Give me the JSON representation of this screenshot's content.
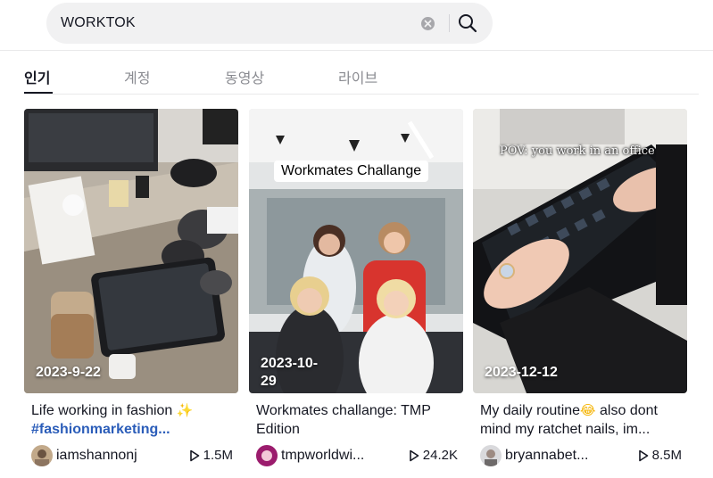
{
  "search": {
    "value": "WORKTOK",
    "placeholder": ""
  },
  "tabs": [
    {
      "label": "인기",
      "active": true
    },
    {
      "label": "계정",
      "active": false
    },
    {
      "label": "동영상",
      "active": false
    },
    {
      "label": "라이브",
      "active": false
    }
  ],
  "colors": {
    "accent": "#161823",
    "hashtag": "#2b5db9",
    "search_bg": "#f1f1f2",
    "muted": "#8a8b91"
  },
  "videos": [
    {
      "date": "2023-9-22",
      "desc_text": "Life working in fashion ",
      "desc_emoji": "✨",
      "hashtag": "#fashionmarketing...",
      "author": "iamshannonj",
      "views": "1.5M"
    },
    {
      "date_line1": "2023-10-",
      "date_line2": "29",
      "overlay_title": "Workmates Challange",
      "desc_text": "Workmates challange: TMP Edition",
      "desc_emoji": "❤",
      "desc_suffix": " ...",
      "author": "tmpworldwi...",
      "views": "24.2K"
    },
    {
      "date": "2023-12-12",
      "overlay_caption": "POV: you work in an office",
      "desc_text": "My daily routine",
      "desc_emoji": "😂",
      "desc_suffix": " also dont mind my ratchet nails, im...",
      "author": "bryannabet...",
      "views": "8.5M"
    }
  ]
}
